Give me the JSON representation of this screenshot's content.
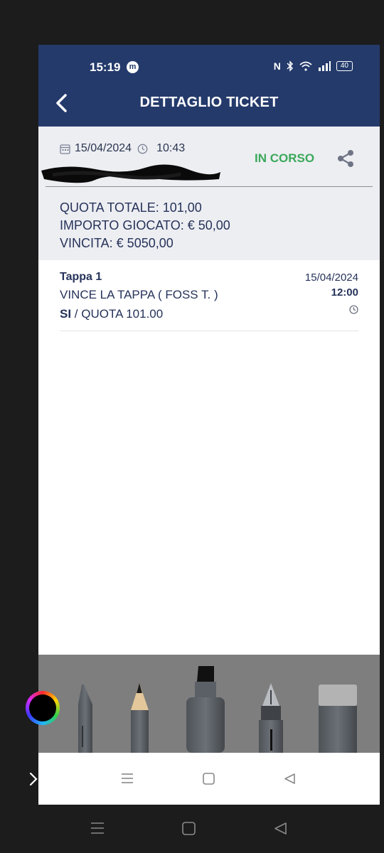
{
  "status_bar": {
    "time": "15:19",
    "app_badge": "m",
    "nfc": "N",
    "battery": "40"
  },
  "header": {
    "title": "DETTAGLIO TICKET"
  },
  "ticket": {
    "date": "15/04/2024",
    "time": "10:43",
    "status": "IN CORSO",
    "totals": {
      "quota_totale": "QUOTA TOTALE:  101,00",
      "importo_giocato": "IMPORTO GIOCATO:  € 50,00",
      "vincita": "VINCITA:  € 5050,00"
    }
  },
  "legs": [
    {
      "title": "Tappa 1",
      "selection": "VINCE LA TAPPA ( FOSS T. )",
      "pick": "SI",
      "odds_text": " / QUOTA 101.00",
      "date": "15/04/2024",
      "time": "12:00"
    }
  ],
  "colors": {
    "header": "#243a6b",
    "status_ok": "#3aa85a",
    "text": "#26335a"
  },
  "icons": [
    "back-arrow-icon",
    "calendar-icon",
    "clock-icon",
    "share-icon",
    "menu-icon",
    "home-icon",
    "back-triangle-icon"
  ]
}
